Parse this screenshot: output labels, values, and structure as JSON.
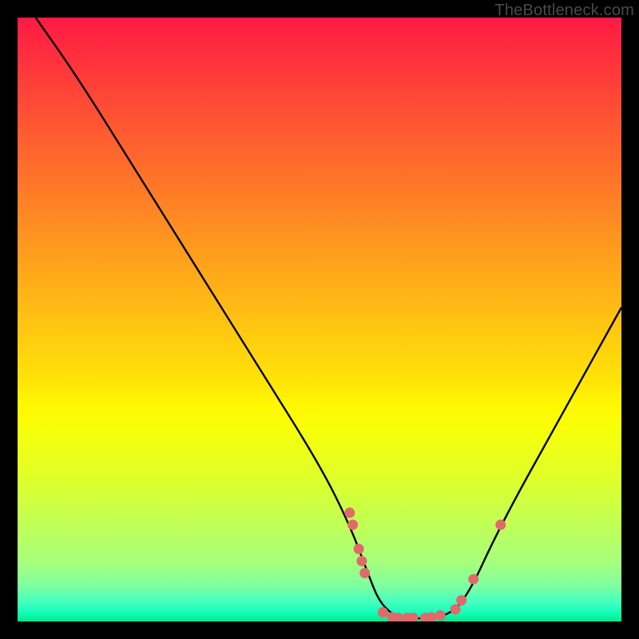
{
  "watermark": "TheBottleneck.com",
  "chart_data": {
    "type": "line",
    "title": "",
    "xlabel": "",
    "ylabel": "",
    "xlim": [
      0,
      100
    ],
    "ylim": [
      0,
      100
    ],
    "series": [
      {
        "name": "curve",
        "x": [
          3,
          10,
          20,
          30,
          40,
          50,
          55,
          58,
          60,
          63,
          66,
          70,
          74,
          80,
          90,
          100
        ],
        "y": [
          100,
          90,
          74,
          58,
          42,
          26,
          16,
          8,
          3,
          0.5,
          0.5,
          0.5,
          3,
          16,
          34,
          52
        ]
      }
    ],
    "markers": {
      "name": "dots",
      "color": "#e06a6a",
      "x": [
        55.0,
        55.5,
        56.5,
        57.0,
        57.5,
        60.5,
        62.0,
        63.0,
        64.5,
        65.5,
        67.5,
        68.5,
        70.0,
        72.5,
        73.5,
        75.5,
        80.0
      ],
      "y": [
        18.0,
        16.0,
        12.0,
        10.0,
        8.0,
        1.5,
        0.7,
        0.6,
        0.6,
        0.6,
        0.6,
        0.7,
        1.0,
        2.0,
        3.5,
        7.0,
        16.0
      ]
    }
  }
}
